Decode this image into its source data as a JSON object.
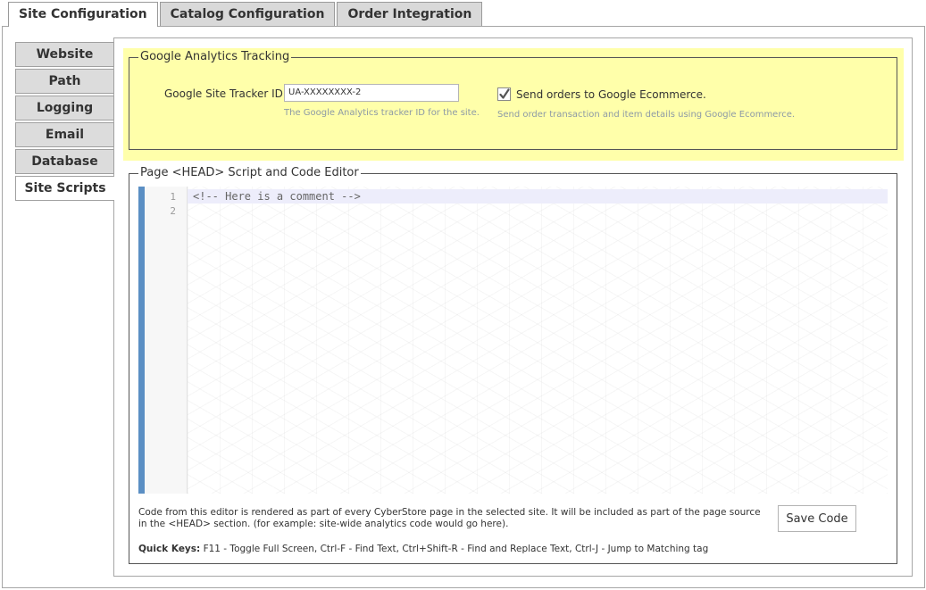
{
  "top_tabs": [
    {
      "label": "Site Configuration",
      "active": true
    },
    {
      "label": "Catalog Configuration",
      "active": false
    },
    {
      "label": "Order Integration",
      "active": false
    }
  ],
  "side_tabs": [
    {
      "label": "Website",
      "active": false
    },
    {
      "label": "Path",
      "active": false
    },
    {
      "label": "Logging",
      "active": false
    },
    {
      "label": "Email",
      "active": false
    },
    {
      "label": "Database",
      "active": false
    },
    {
      "label": "Site Scripts",
      "active": true
    }
  ],
  "google_analytics": {
    "legend": "Google Analytics Tracking",
    "tracker_label": "Google Site Tracker ID:",
    "tracker_value": "UA-XXXXXXXX-2",
    "tracker_hint": "The Google Analytics tracker ID for the site.",
    "ecommerce_checked": true,
    "ecommerce_label": "Send orders to Google Ecommerce.",
    "ecommerce_hint": "Send order transaction and item details using Google Ecommerce.",
    "highlight_color": "#ffffaa"
  },
  "code_editor": {
    "legend": "Page <HEAD> Script and Code Editor",
    "lines": [
      {
        "number": "1",
        "text": "<!-- Here is a comment -->"
      },
      {
        "number": "2",
        "text": ""
      }
    ],
    "description": "Code from this editor is rendered as part of every CyberStore page in the selected site. It will be included as part of the page source in the <HEAD> section. (for example: site-wide analytics code would go here).",
    "save_label": "Save Code",
    "quick_keys_label": "Quick Keys:",
    "quick_keys_text": " F11 - Toggle Full Screen, Ctrl-F - Find Text, Ctrl+Shift-R - Find and Replace Text, Ctrl-J - Jump to Matching tag",
    "accent_color": "#5b8fc4"
  }
}
